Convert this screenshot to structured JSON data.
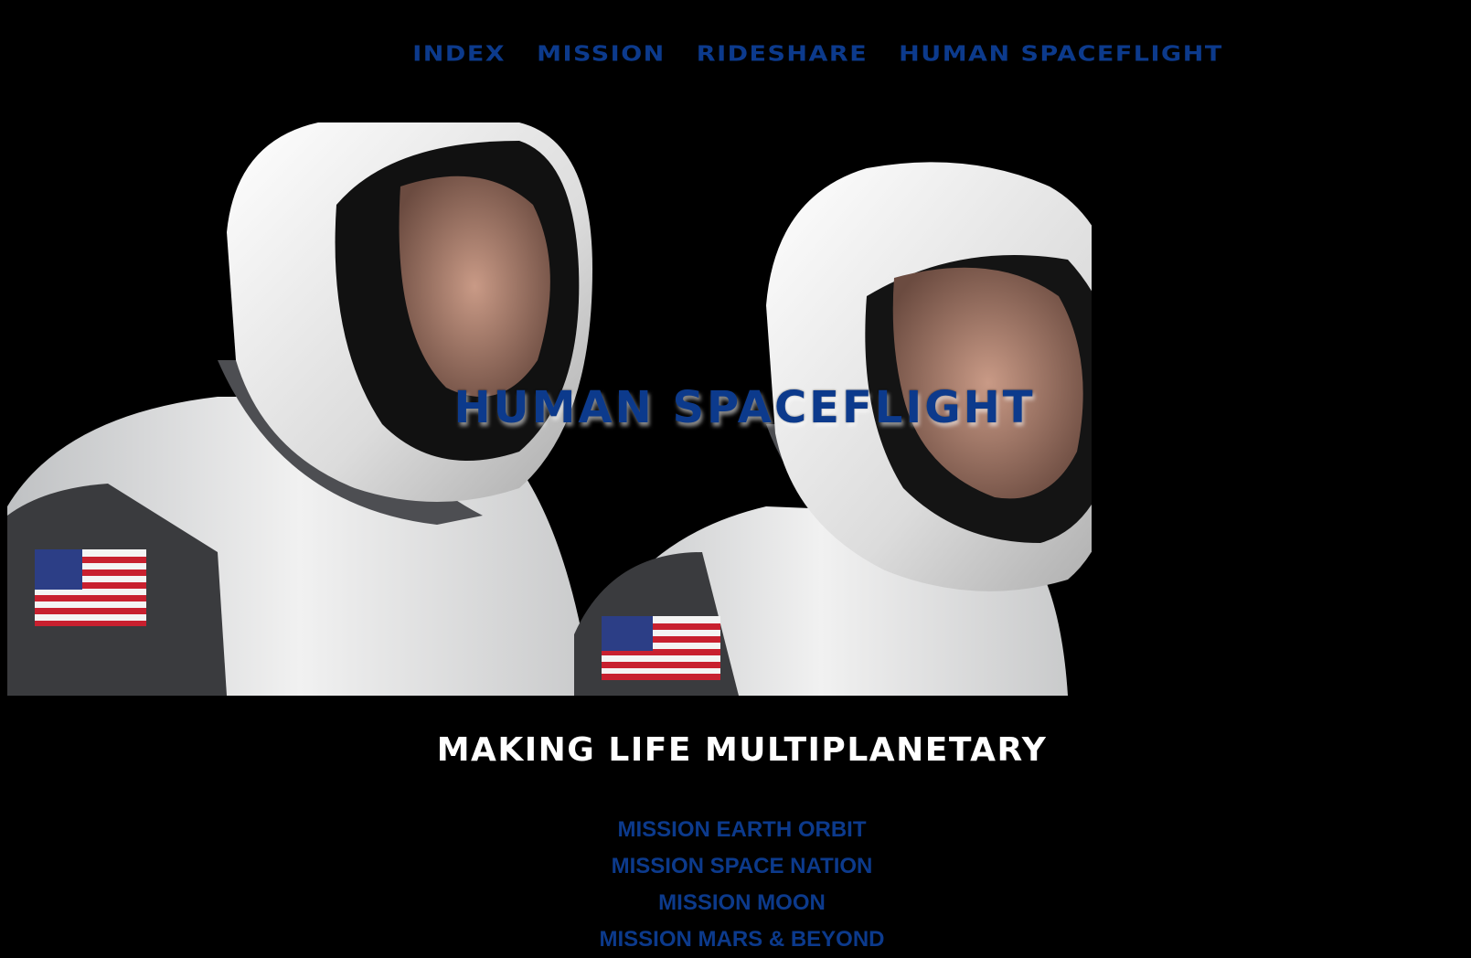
{
  "nav": {
    "items": [
      {
        "label": "INDEX"
      },
      {
        "label": "MISSION"
      },
      {
        "label": "RIDESHARE"
      },
      {
        "label": "HUMAN SPACEFLIGHT"
      }
    ]
  },
  "hero": {
    "title": "HUMAN SPACEFLIGHT",
    "image": "two-astronauts-in-spacesuits-photo"
  },
  "tagline": "MAKING LIFE MULTIPLANETARY",
  "missions": [
    {
      "label": "MISSION EARTH ORBIT"
    },
    {
      "label": "MISSION SPACE NATION"
    },
    {
      "label": "MISSION MOON"
    },
    {
      "label": "MISSION MARS & BEYOND"
    }
  ],
  "colors": {
    "background": "#000000",
    "link": "#0c3a8c",
    "tagline": "#ffffff"
  }
}
